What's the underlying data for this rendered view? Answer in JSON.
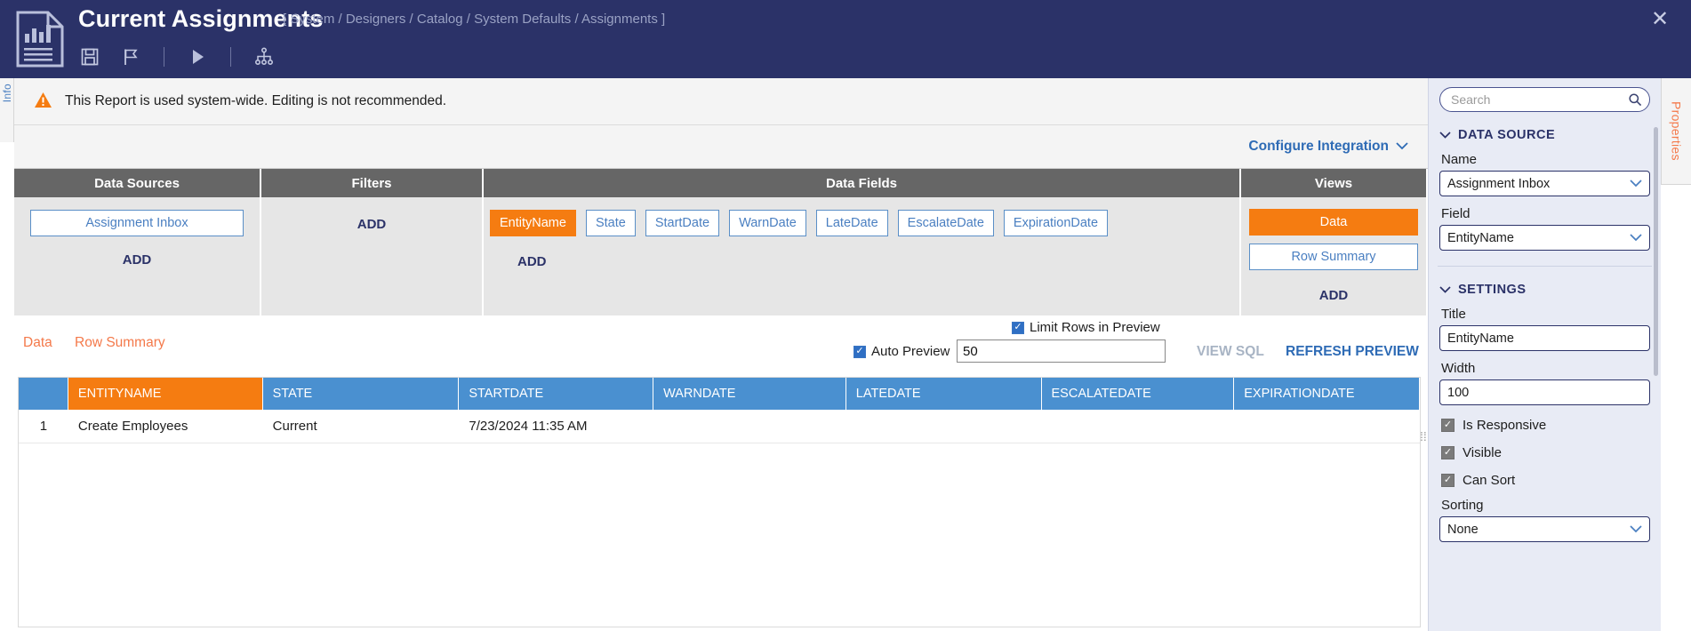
{
  "header": {
    "title": "Current Assignments",
    "breadcrumb": "[ System / Designers / Catalog / System Defaults / Assignments ]",
    "close_label": "✕",
    "toolbar": [
      {
        "name": "save-icon",
        "label": "Save"
      },
      {
        "name": "flag-icon",
        "label": "Flag"
      },
      {
        "name": "run-icon",
        "label": "Run"
      },
      {
        "name": "hierarchy-icon",
        "label": "Hierarchy"
      }
    ]
  },
  "info_tab": {
    "label": "Info"
  },
  "warning": {
    "text": "This Report is used system-wide. Editing is not recommended.",
    "icon": "warning-triangle-icon",
    "color": "#f57c11"
  },
  "config_row": {
    "link_label": "Configure Integration",
    "chevron": "⌄"
  },
  "builder": {
    "columns": [
      {
        "header": "Data Sources"
      },
      {
        "header": "Filters"
      },
      {
        "header": "Data Fields"
      },
      {
        "header": "Views"
      }
    ],
    "data_sources": {
      "items": [
        {
          "label": "Assignment Inbox",
          "selected": false
        }
      ],
      "add_label": "ADD"
    },
    "filters": {
      "add_label": "ADD"
    },
    "data_fields": {
      "items": [
        {
          "label": "EntityName",
          "selected": true
        },
        {
          "label": "State",
          "selected": false
        },
        {
          "label": "StartDate",
          "selected": false
        },
        {
          "label": "WarnDate",
          "selected": false
        },
        {
          "label": "LateDate",
          "selected": false
        },
        {
          "label": "EscalateDate",
          "selected": false
        },
        {
          "label": "ExpirationDate",
          "selected": false
        }
      ],
      "add_label": "ADD"
    },
    "views": {
      "items": [
        {
          "label": "Data",
          "selected": true
        },
        {
          "label": "Row Summary",
          "selected": false
        }
      ],
      "add_label": "ADD"
    }
  },
  "preview_bar": {
    "tabs": [
      {
        "label": "Data"
      },
      {
        "label": "Row Summary"
      }
    ],
    "limit_rows_label": "Limit Rows in Preview",
    "limit_rows_checked": true,
    "auto_preview_label": "Auto Preview",
    "auto_preview_checked": true,
    "rows_value": "50",
    "view_sql_label": "VIEW SQL",
    "view_sql_enabled": false,
    "refresh_preview_label": "REFRESH PREVIEW",
    "check_glyph": "✓"
  },
  "grid": {
    "headers": [
      "",
      "ENTITYNAME",
      "STATE",
      "STARTDATE",
      "WARNDATE",
      "LATEDATE",
      "ESCALATEDATE",
      "EXPIRATIONDATE"
    ],
    "selected_header_index": 1,
    "rows": [
      {
        "index": "1",
        "entityname": "Create Employees",
        "state": "Current",
        "startdate": "7/23/2024 11:35 AM",
        "warndate": "",
        "latedate": "",
        "escalatedate": "",
        "expirationdate": ""
      }
    ]
  },
  "properties_panel": {
    "tab_label": "Properties",
    "search_placeholder": "Search",
    "search_value": "",
    "sections": [
      {
        "title": "DATA SOURCE",
        "fields": [
          {
            "label": "Name",
            "value": "Assignment Inbox",
            "type": "select"
          },
          {
            "label": "Field",
            "value": "EntityName",
            "type": "select"
          }
        ]
      },
      {
        "title": "SETTINGS",
        "fields": [
          {
            "label": "Title",
            "value": "EntityName",
            "type": "text"
          },
          {
            "label": "Width",
            "value": "100",
            "type": "text"
          }
        ],
        "checkboxes": [
          {
            "label": "Is Responsive",
            "checked": true
          },
          {
            "label": "Visible",
            "checked": true
          },
          {
            "label": "Can Sort",
            "checked": true
          }
        ],
        "trailing_fields": [
          {
            "label": "Sorting",
            "value": "None",
            "type": "select"
          }
        ]
      }
    ],
    "chevron": "⌄",
    "collapse_glyph": "⌄",
    "check_glyph": "✓"
  },
  "colors": {
    "header_blue": "#2b3268",
    "accent_orange": "#f57c11",
    "link_blue": "#2e6bb5",
    "grid_header_blue": "#4a90d0",
    "panel_bg": "#e8ebf5"
  }
}
